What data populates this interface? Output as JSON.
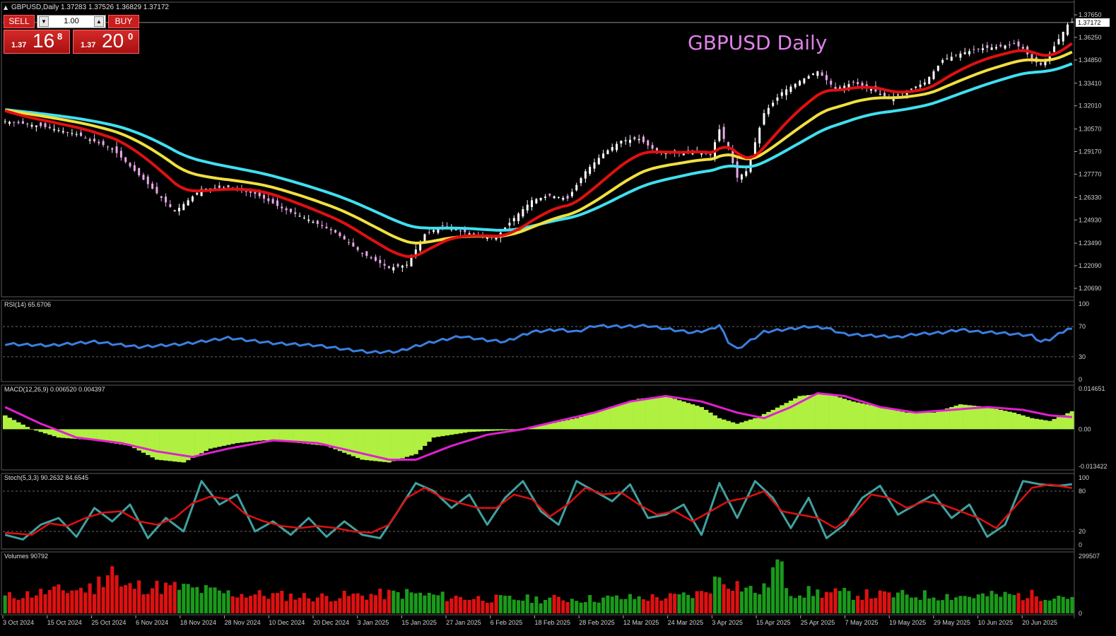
{
  "header": {
    "symbol_line": "GBPUSD,Daily  1.37283 1.37526 1.36829 1.37172"
  },
  "watermark_title": "GBPUSD Daily",
  "trade_panel": {
    "sell_label": "SELL",
    "buy_label": "BUY",
    "lot": "1.00",
    "bid_small": "1.37",
    "bid_big": "16",
    "bid_sup": "8",
    "ask_small": "1.37",
    "ask_big": "20",
    "ask_sup": "0"
  },
  "colors": {
    "ema_fast": "#e01010",
    "ema_mid": "#f0e040",
    "ema_slow": "#40e0f0",
    "rsi": "#3a7fe0",
    "macd_hist": "#b0f040",
    "macd_signal": "#e020d0",
    "stoch_main": "#40a0a0",
    "stoch_signal": "#e01010",
    "vol_up": "#1a9a1a",
    "vol_down": "#e01010",
    "candle_up": "#ffffff",
    "candle_down": "#e8a8e8",
    "price_line": "#c0c0c0"
  },
  "chart_data": [
    {
      "type": "candlestick",
      "name": "price",
      "current_price": 1.37172,
      "ylim": [
        1.2069,
        1.3765
      ],
      "yticks": [
        "1.37650",
        "1.36250",
        "1.34850",
        "1.33410",
        "1.32010",
        "1.30570",
        "1.29170",
        "1.27770",
        "1.26330",
        "1.24930",
        "1.23490",
        "1.22090",
        "1.20690"
      ],
      "xticks": [
        "3 Oct 2024",
        "15 Oct 2024",
        "25 Oct 2024",
        "6 Nov 2024",
        "18 Nov 2024",
        "28 Nov 2024",
        "10 Dec 2024",
        "20 Dec 2024",
        "3 Jan 2025",
        "15 Jan 2025",
        "27 Jan 2025",
        "6 Feb 2025",
        "18 Feb 2025",
        "28 Feb 2025",
        "12 Mar 2025",
        "24 Mar 2025",
        "3 Apr 2025",
        "15 Apr 2025",
        "25 Apr 2025",
        "7 May 2025",
        "19 May 2025",
        "29 May 2025",
        "10 Jun 2025",
        "20 Jun 2025"
      ],
      "close_anchors": [
        [
          0,
          1.3105
        ],
        [
          8,
          1.3075
        ],
        [
          16,
          1.3025
        ],
        [
          24,
          1.2935
        ],
        [
          32,
          1.2715
        ],
        [
          38,
          1.2545
        ],
        [
          44,
          1.2685
        ],
        [
          50,
          1.2695
        ],
        [
          56,
          1.2655
        ],
        [
          62,
          1.2565
        ],
        [
          68,
          1.2495
        ],
        [
          74,
          1.2415
        ],
        [
          80,
          1.2285
        ],
        [
          86,
          1.2195
        ],
        [
          90,
          1.2215
        ],
        [
          94,
          1.2405
        ],
        [
          98,
          1.2455
        ],
        [
          102,
          1.2425
        ],
        [
          106,
          1.2395
        ],
        [
          110,
          1.2385
        ],
        [
          114,
          1.2505
        ],
        [
          118,
          1.2615
        ],
        [
          122,
          1.2645
        ],
        [
          126,
          1.2625
        ],
        [
          130,
          1.2795
        ],
        [
          134,
          1.2905
        ],
        [
          138,
          1.2985
        ],
        [
          142,
          1.2995
        ],
        [
          146,
          1.2915
        ],
        [
          150,
          1.2905
        ],
        [
          154,
          1.2925
        ],
        [
          158,
          1.2895
        ],
        [
          160,
          1.3055
        ],
        [
          162,
          1.2935
        ],
        [
          164,
          1.2755
        ],
        [
          166,
          1.2795
        ],
        [
          170,
          1.3155
        ],
        [
          174,
          1.3285
        ],
        [
          178,
          1.3355
        ],
        [
          182,
          1.3415
        ],
        [
          186,
          1.3305
        ],
        [
          190,
          1.3345
        ],
        [
          194,
          1.3305
        ],
        [
          198,
          1.3245
        ],
        [
          202,
          1.3295
        ],
        [
          206,
          1.3345
        ],
        [
          210,
          1.3485
        ],
        [
          214,
          1.3525
        ],
        [
          218,
          1.3555
        ],
        [
          222,
          1.3565
        ],
        [
          226,
          1.3585
        ],
        [
          228,
          1.3555
        ],
        [
          230,
          1.3485
        ],
        [
          232,
          1.3455
        ],
        [
          234,
          1.3525
        ],
        [
          236,
          1.3615
        ],
        [
          238,
          1.3705
        ],
        [
          239,
          1.37172
        ]
      ]
    },
    {
      "type": "line",
      "name": "RSI(14)",
      "header": "RSI(14) 65.6706",
      "ylim": [
        0,
        100
      ],
      "yticks": [
        "100",
        "70",
        "30",
        "0"
      ],
      "levels": [
        70,
        30
      ],
      "anchors": [
        [
          0,
          47
        ],
        [
          10,
          45
        ],
        [
          20,
          50
        ],
        [
          30,
          43
        ],
        [
          40,
          47
        ],
        [
          50,
          55
        ],
        [
          60,
          48
        ],
        [
          70,
          45
        ],
        [
          76,
          40
        ],
        [
          82,
          36
        ],
        [
          88,
          37
        ],
        [
          92,
          44
        ],
        [
          96,
          50
        ],
        [
          102,
          57
        ],
        [
          108,
          52
        ],
        [
          112,
          50
        ],
        [
          118,
          63
        ],
        [
          124,
          66
        ],
        [
          128,
          63
        ],
        [
          132,
          71
        ],
        [
          138,
          70
        ],
        [
          144,
          71
        ],
        [
          148,
          67
        ],
        [
          154,
          62
        ],
        [
          158,
          66
        ],
        [
          160,
          72
        ],
        [
          162,
          50
        ],
        [
          164,
          40
        ],
        [
          170,
          63
        ],
        [
          176,
          67
        ],
        [
          180,
          70
        ],
        [
          184,
          68
        ],
        [
          188,
          60
        ],
        [
          194,
          58
        ],
        [
          200,
          56
        ],
        [
          204,
          60
        ],
        [
          210,
          62
        ],
        [
          214,
          66
        ],
        [
          218,
          63
        ],
        [
          222,
          62
        ],
        [
          226,
          60
        ],
        [
          230,
          58
        ],
        [
          232,
          50
        ],
        [
          234,
          53
        ],
        [
          236,
          60
        ],
        [
          238,
          67
        ],
        [
          239,
          65.67
        ]
      ]
    },
    {
      "type": "histogram+line",
      "name": "MACD(12,26,9)",
      "header": "MACD(12,26,9) 0.006520 0.004397",
      "ylim": [
        -0.013422,
        0.014651
      ],
      "yticks": [
        "0.014651",
        "0.00",
        "-0.013422"
      ],
      "hist_anchors": [
        [
          0,
          0.005
        ],
        [
          6,
          0.0
        ],
        [
          12,
          -0.003
        ],
        [
          20,
          -0.004
        ],
        [
          28,
          -0.006
        ],
        [
          34,
          -0.011
        ],
        [
          40,
          -0.012
        ],
        [
          46,
          -0.007
        ],
        [
          52,
          -0.005
        ],
        [
          58,
          -0.004
        ],
        [
          66,
          -0.005
        ],
        [
          72,
          -0.006
        ],
        [
          80,
          -0.011
        ],
        [
          86,
          -0.012
        ],
        [
          92,
          -0.009
        ],
        [
          96,
          -0.003
        ],
        [
          104,
          -0.001
        ],
        [
          110,
          -0.0005
        ],
        [
          116,
          0.0
        ],
        [
          122,
          0.002
        ],
        [
          128,
          0.004
        ],
        [
          136,
          0.008
        ],
        [
          142,
          0.011
        ],
        [
          148,
          0.012
        ],
        [
          152,
          0.01
        ],
        [
          156,
          0.008
        ],
        [
          160,
          0.004
        ],
        [
          164,
          0.002
        ],
        [
          168,
          0.004
        ],
        [
          172,
          0.007
        ],
        [
          178,
          0.012
        ],
        [
          184,
          0.013
        ],
        [
          190,
          0.01
        ],
        [
          196,
          0.008
        ],
        [
          202,
          0.006
        ],
        [
          208,
          0.006
        ],
        [
          214,
          0.009
        ],
        [
          220,
          0.008
        ],
        [
          226,
          0.006
        ],
        [
          230,
          0.004
        ],
        [
          234,
          0.003
        ],
        [
          239,
          0.0065
        ]
      ],
      "signal_anchors": [
        [
          0,
          0.008
        ],
        [
          8,
          0.002
        ],
        [
          16,
          -0.003
        ],
        [
          26,
          -0.005
        ],
        [
          34,
          -0.008
        ],
        [
          42,
          -0.01
        ],
        [
          50,
          -0.007
        ],
        [
          60,
          -0.004
        ],
        [
          70,
          -0.005
        ],
        [
          78,
          -0.008
        ],
        [
          86,
          -0.011
        ],
        [
          92,
          -0.011
        ],
        [
          100,
          -0.006
        ],
        [
          108,
          -0.002
        ],
        [
          116,
          0.0
        ],
        [
          124,
          0.003
        ],
        [
          132,
          0.006
        ],
        [
          140,
          0.01
        ],
        [
          148,
          0.012
        ],
        [
          156,
          0.01
        ],
        [
          164,
          0.006
        ],
        [
          170,
          0.004
        ],
        [
          176,
          0.008
        ],
        [
          182,
          0.013
        ],
        [
          188,
          0.012
        ],
        [
          196,
          0.008
        ],
        [
          204,
          0.006
        ],
        [
          212,
          0.007
        ],
        [
          220,
          0.008
        ],
        [
          228,
          0.007
        ],
        [
          234,
          0.005
        ],
        [
          239,
          0.0044
        ]
      ]
    },
    {
      "type": "line",
      "name": "Stoch(5,3,3)",
      "header": "Stoch(5,3,3) 90.2632 84.6545",
      "ylim": [
        0,
        100
      ],
      "yticks": [
        "100",
        "80",
        "20",
        "0"
      ],
      "levels": [
        80,
        20
      ],
      "main_anchors": [
        [
          0,
          15
        ],
        [
          4,
          8
        ],
        [
          8,
          30
        ],
        [
          12,
          40
        ],
        [
          16,
          12
        ],
        [
          20,
          55
        ],
        [
          24,
          35
        ],
        [
          28,
          60
        ],
        [
          32,
          10
        ],
        [
          36,
          40
        ],
        [
          40,
          20
        ],
        [
          44,
          95
        ],
        [
          48,
          60
        ],
        [
          52,
          75
        ],
        [
          56,
          20
        ],
        [
          60,
          35
        ],
        [
          64,
          15
        ],
        [
          68,
          40
        ],
        [
          72,
          12
        ],
        [
          76,
          35
        ],
        [
          80,
          15
        ],
        [
          84,
          10
        ],
        [
          88,
          50
        ],
        [
          92,
          92
        ],
        [
          96,
          80
        ],
        [
          100,
          55
        ],
        [
          104,
          75
        ],
        [
          108,
          30
        ],
        [
          112,
          70
        ],
        [
          116,
          95
        ],
        [
          120,
          50
        ],
        [
          124,
          30
        ],
        [
          128,
          95
        ],
        [
          132,
          80
        ],
        [
          136,
          65
        ],
        [
          140,
          90
        ],
        [
          144,
          40
        ],
        [
          148,
          45
        ],
        [
          152,
          60
        ],
        [
          156,
          15
        ],
        [
          160,
          92
        ],
        [
          164,
          40
        ],
        [
          168,
          95
        ],
        [
          172,
          70
        ],
        [
          176,
          25
        ],
        [
          180,
          70
        ],
        [
          184,
          10
        ],
        [
          188,
          30
        ],
        [
          192,
          70
        ],
        [
          196,
          88
        ],
        [
          200,
          45
        ],
        [
          204,
          60
        ],
        [
          208,
          75
        ],
        [
          212,
          40
        ],
        [
          216,
          60
        ],
        [
          220,
          12
        ],
        [
          224,
          30
        ],
        [
          228,
          95
        ],
        [
          232,
          90
        ],
        [
          236,
          88
        ],
        [
          239,
          90.26
        ]
      ],
      "signal_anchors": [
        [
          0,
          18
        ],
        [
          6,
          15
        ],
        [
          10,
          32
        ],
        [
          14,
          28
        ],
        [
          18,
          40
        ],
        [
          22,
          48
        ],
        [
          26,
          50
        ],
        [
          30,
          35
        ],
        [
          34,
          30
        ],
        [
          38,
          40
        ],
        [
          42,
          62
        ],
        [
          46,
          72
        ],
        [
          50,
          68
        ],
        [
          54,
          45
        ],
        [
          58,
          35
        ],
        [
          62,
          28
        ],
        [
          66,
          25
        ],
        [
          70,
          28
        ],
        [
          74,
          25
        ],
        [
          78,
          20
        ],
        [
          82,
          18
        ],
        [
          86,
          30
        ],
        [
          90,
          70
        ],
        [
          94,
          85
        ],
        [
          98,
          70
        ],
        [
          102,
          62
        ],
        [
          106,
          55
        ],
        [
          110,
          55
        ],
        [
          114,
          75
        ],
        [
          118,
          68
        ],
        [
          122,
          42
        ],
        [
          126,
          60
        ],
        [
          130,
          85
        ],
        [
          134,
          75
        ],
        [
          138,
          78
        ],
        [
          142,
          60
        ],
        [
          146,
          45
        ],
        [
          150,
          50
        ],
        [
          154,
          35
        ],
        [
          158,
          50
        ],
        [
          162,
          65
        ],
        [
          166,
          70
        ],
        [
          170,
          80
        ],
        [
          174,
          50
        ],
        [
          178,
          45
        ],
        [
          182,
          40
        ],
        [
          186,
          25
        ],
        [
          190,
          45
        ],
        [
          194,
          75
        ],
        [
          198,
          70
        ],
        [
          202,
          55
        ],
        [
          206,
          65
        ],
        [
          210,
          60
        ],
        [
          214,
          50
        ],
        [
          218,
          40
        ],
        [
          222,
          25
        ],
        [
          226,
          55
        ],
        [
          230,
          85
        ],
        [
          234,
          90
        ],
        [
          239,
          84.65
        ]
      ]
    },
    {
      "type": "bar",
      "name": "Volumes",
      "header": "Volumes 90792",
      "ylim": [
        0,
        299507
      ],
      "yticks": [
        "299507",
        "0"
      ],
      "anchors": [
        [
          0,
          90000
        ],
        [
          10,
          120000
        ],
        [
          20,
          140000
        ],
        [
          24,
          270000
        ],
        [
          26,
          140000
        ],
        [
          30,
          150000
        ],
        [
          40,
          140000
        ],
        [
          50,
          110000
        ],
        [
          60,
          100000
        ],
        [
          70,
          90000
        ],
        [
          80,
          100000
        ],
        [
          90,
          110000
        ],
        [
          100,
          90000
        ],
        [
          110,
          80000
        ],
        [
          120,
          80000
        ],
        [
          130,
          80000
        ],
        [
          140,
          85000
        ],
        [
          150,
          90000
        ],
        [
          156,
          110000
        ],
        [
          158,
          150000
        ],
        [
          160,
          200000
        ],
        [
          162,
          180000
        ],
        [
          164,
          160000
        ],
        [
          168,
          120000
        ],
        [
          170,
          130000
        ],
        [
          173,
          280000
        ],
        [
          176,
          120000
        ],
        [
          186,
          110000
        ],
        [
          196,
          100000
        ],
        [
          206,
          100000
        ],
        [
          216,
          95000
        ],
        [
          226,
          100000
        ],
        [
          236,
          100000
        ],
        [
          239,
          90792
        ]
      ]
    }
  ]
}
